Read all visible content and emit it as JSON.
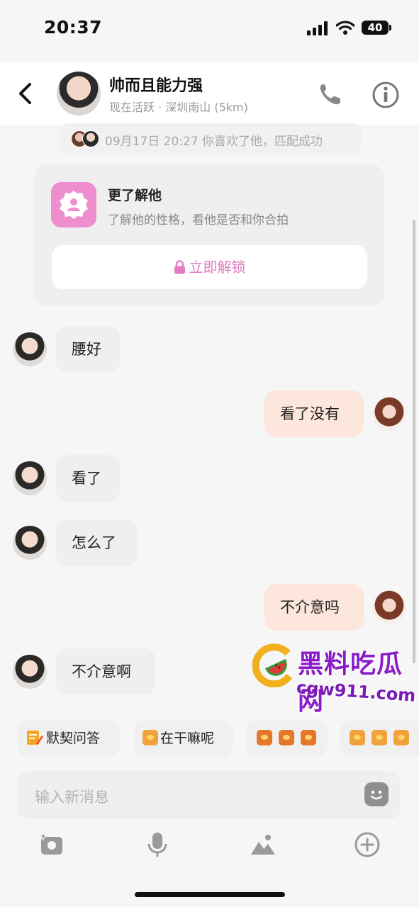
{
  "status_bar": {
    "time": "20:37",
    "battery": "40"
  },
  "header": {
    "contact_name": "帅而且能力强",
    "contact_status": "现在活跃 · 深圳南山 (5km)"
  },
  "match_notice": {
    "text": "09月17日 20:27 你喜欢了他，匹配成功"
  },
  "unlock_card": {
    "title": "更了解他",
    "subtitle": "了解他的性格，看他是否和你合拍",
    "button_label": "立即解锁"
  },
  "messages": [
    {
      "from": "him",
      "text": "腰好"
    },
    {
      "from": "me",
      "text": "看了没有"
    },
    {
      "from": "him",
      "text": "看了"
    },
    {
      "from": "him",
      "text": "怎么了"
    },
    {
      "from": "me",
      "text": "不介意吗"
    },
    {
      "from": "him",
      "text": "不介意啊"
    }
  ],
  "watermark": {
    "line1": "黑料吃瓜网",
    "line2": "cgw911.com"
  },
  "quick_replies": [
    {
      "label": "默契问答",
      "icon": "quiz-icon"
    },
    {
      "label": "在干嘛呢",
      "icon": "tiger-emoji-icon"
    },
    {
      "label": "",
      "icon": "tiger-emoji-icon"
    },
    {
      "label": "",
      "icon": "tiger-emoji-icon"
    }
  ],
  "input": {
    "placeholder": "输入新消息"
  },
  "colors": {
    "accent_pink": "#e27cc3",
    "outgoing_bubble": "#fde7dc",
    "incoming_bubble": "#efefef"
  }
}
